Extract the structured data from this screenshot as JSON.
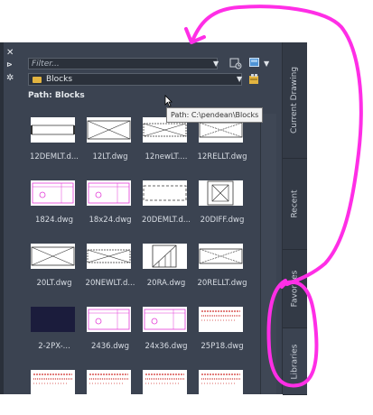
{
  "panel": {
    "filter_placeholder": "Filter...",
    "folder_name": "Blocks",
    "path_label": "Path: Blocks",
    "tooltip": "Path: C:\\pendean\\Blocks"
  },
  "side_tabs": [
    "Current Drawing",
    "Recent",
    "Favorites",
    "Libraries"
  ],
  "active_tab": "Libraries",
  "items": [
    {
      "label": "12DEMLT.d...",
      "thumb": "demlt"
    },
    {
      "label": "12LT.dwg",
      "thumb": "lt"
    },
    {
      "label": "12newLT....",
      "thumb": "newlt"
    },
    {
      "label": "12RELLT.dwg",
      "thumb": "rellt"
    },
    {
      "label": "1824.dwg",
      "thumb": "pink"
    },
    {
      "label": "18x24.dwg",
      "thumb": "pink"
    },
    {
      "label": "20DEMLT.d...",
      "thumb": "dashed"
    },
    {
      "label": "20DIFF.dwg",
      "thumb": "diff"
    },
    {
      "label": "20LT.dwg",
      "thumb": "lt"
    },
    {
      "label": "20NEWLT.d...",
      "thumb": "newlt"
    },
    {
      "label": "20RA.dwg",
      "thumb": "ra"
    },
    {
      "label": "20RELLT.dwg",
      "thumb": "rellt"
    },
    {
      "label": "2-2PX-...",
      "thumb": "dark"
    },
    {
      "label": "2436.dwg",
      "thumb": "pink"
    },
    {
      "label": "24x36.dwg",
      "thumb": "pink"
    },
    {
      "label": "25P18.dwg",
      "thumb": "redtext"
    },
    {
      "label": "",
      "thumb": "redtext"
    },
    {
      "label": "",
      "thumb": "redtext"
    },
    {
      "label": "",
      "thumb": "redtext"
    },
    {
      "label": "",
      "thumb": "redtext"
    }
  ],
  "colors": {
    "panel_bg": "#3b4351",
    "field_bg": "#2b313b",
    "annotation_pen": "#ff2ee6",
    "thumb_pink": "#e33ad7",
    "thumb_red": "#d0312d",
    "folder_yellow": "#e3b440"
  }
}
